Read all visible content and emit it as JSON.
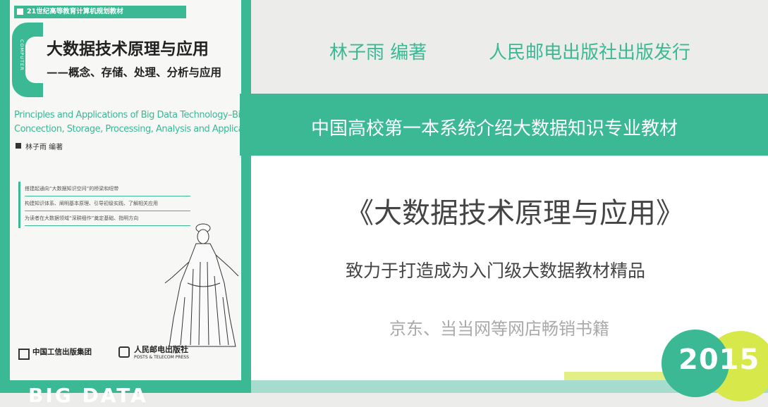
{
  "cover": {
    "series": "21世纪高等教育计算机规划教材",
    "logo_vertical": "COMPUTER",
    "title": "大数据技术原理与应用",
    "subtitle": "——概念、存储、处理、分析与应用",
    "en_line1": "Principles and Applications of Big Data Technology–Big Data",
    "en_line2": "Concection, Storage, Processing, Analysis and Application",
    "author": "林子雨 编著",
    "bullets": [
      "搭建起通向“大数据知识空间”的桥梁和纽带",
      "构建知识体系、阐明基本原理、引导初级实践、了解相关应用",
      "为读者在大数据领域“深耕细作”奠定基础、指明方向"
    ],
    "publisher1": "中国工信出版集团",
    "publisher2": "人民邮电出版社",
    "publisher2_en": "POSTS & TELECOM PRESS",
    "bottom_text": "BIG DATA"
  },
  "header": {
    "author": "林子雨  编著",
    "publisher": "人民邮电出版社出版发行"
  },
  "banner": {
    "text": "中国高校第一本系统介绍大数据知识专业教材"
  },
  "main": {
    "book_title": "《大数据技术原理与应用》",
    "tagline": "致力于打造成为入门级大数据教材精品",
    "sales": "京东、当当网等网店畅销书籍",
    "year": "2015"
  },
  "colors": {
    "accent": "#3bb994",
    "yellow": "#d6e84a",
    "text": "#444444"
  }
}
